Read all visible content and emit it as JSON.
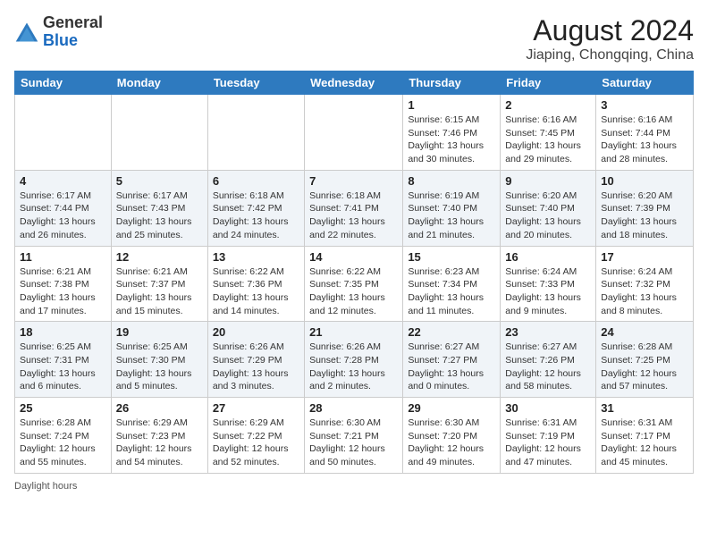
{
  "header": {
    "logo_general": "General",
    "logo_blue": "Blue",
    "month_year": "August 2024",
    "location": "Jiaping, Chongqing, China"
  },
  "weekdays": [
    "Sunday",
    "Monday",
    "Tuesday",
    "Wednesday",
    "Thursday",
    "Friday",
    "Saturday"
  ],
  "weeks": [
    [
      {
        "day": "",
        "info": ""
      },
      {
        "day": "",
        "info": ""
      },
      {
        "day": "",
        "info": ""
      },
      {
        "day": "",
        "info": ""
      },
      {
        "day": "1",
        "info": "Sunrise: 6:15 AM\nSunset: 7:46 PM\nDaylight: 13 hours and 30 minutes."
      },
      {
        "day": "2",
        "info": "Sunrise: 6:16 AM\nSunset: 7:45 PM\nDaylight: 13 hours and 29 minutes."
      },
      {
        "day": "3",
        "info": "Sunrise: 6:16 AM\nSunset: 7:44 PM\nDaylight: 13 hours and 28 minutes."
      }
    ],
    [
      {
        "day": "4",
        "info": "Sunrise: 6:17 AM\nSunset: 7:44 PM\nDaylight: 13 hours and 26 minutes."
      },
      {
        "day": "5",
        "info": "Sunrise: 6:17 AM\nSunset: 7:43 PM\nDaylight: 13 hours and 25 minutes."
      },
      {
        "day": "6",
        "info": "Sunrise: 6:18 AM\nSunset: 7:42 PM\nDaylight: 13 hours and 24 minutes."
      },
      {
        "day": "7",
        "info": "Sunrise: 6:18 AM\nSunset: 7:41 PM\nDaylight: 13 hours and 22 minutes."
      },
      {
        "day": "8",
        "info": "Sunrise: 6:19 AM\nSunset: 7:40 PM\nDaylight: 13 hours and 21 minutes."
      },
      {
        "day": "9",
        "info": "Sunrise: 6:20 AM\nSunset: 7:40 PM\nDaylight: 13 hours and 20 minutes."
      },
      {
        "day": "10",
        "info": "Sunrise: 6:20 AM\nSunset: 7:39 PM\nDaylight: 13 hours and 18 minutes."
      }
    ],
    [
      {
        "day": "11",
        "info": "Sunrise: 6:21 AM\nSunset: 7:38 PM\nDaylight: 13 hours and 17 minutes."
      },
      {
        "day": "12",
        "info": "Sunrise: 6:21 AM\nSunset: 7:37 PM\nDaylight: 13 hours and 15 minutes."
      },
      {
        "day": "13",
        "info": "Sunrise: 6:22 AM\nSunset: 7:36 PM\nDaylight: 13 hours and 14 minutes."
      },
      {
        "day": "14",
        "info": "Sunrise: 6:22 AM\nSunset: 7:35 PM\nDaylight: 13 hours and 12 minutes."
      },
      {
        "day": "15",
        "info": "Sunrise: 6:23 AM\nSunset: 7:34 PM\nDaylight: 13 hours and 11 minutes."
      },
      {
        "day": "16",
        "info": "Sunrise: 6:24 AM\nSunset: 7:33 PM\nDaylight: 13 hours and 9 minutes."
      },
      {
        "day": "17",
        "info": "Sunrise: 6:24 AM\nSunset: 7:32 PM\nDaylight: 13 hours and 8 minutes."
      }
    ],
    [
      {
        "day": "18",
        "info": "Sunrise: 6:25 AM\nSunset: 7:31 PM\nDaylight: 13 hours and 6 minutes."
      },
      {
        "day": "19",
        "info": "Sunrise: 6:25 AM\nSunset: 7:30 PM\nDaylight: 13 hours and 5 minutes."
      },
      {
        "day": "20",
        "info": "Sunrise: 6:26 AM\nSunset: 7:29 PM\nDaylight: 13 hours and 3 minutes."
      },
      {
        "day": "21",
        "info": "Sunrise: 6:26 AM\nSunset: 7:28 PM\nDaylight: 13 hours and 2 minutes."
      },
      {
        "day": "22",
        "info": "Sunrise: 6:27 AM\nSunset: 7:27 PM\nDaylight: 13 hours and 0 minutes."
      },
      {
        "day": "23",
        "info": "Sunrise: 6:27 AM\nSunset: 7:26 PM\nDaylight: 12 hours and 58 minutes."
      },
      {
        "day": "24",
        "info": "Sunrise: 6:28 AM\nSunset: 7:25 PM\nDaylight: 12 hours and 57 minutes."
      }
    ],
    [
      {
        "day": "25",
        "info": "Sunrise: 6:28 AM\nSunset: 7:24 PM\nDaylight: 12 hours and 55 minutes."
      },
      {
        "day": "26",
        "info": "Sunrise: 6:29 AM\nSunset: 7:23 PM\nDaylight: 12 hours and 54 minutes."
      },
      {
        "day": "27",
        "info": "Sunrise: 6:29 AM\nSunset: 7:22 PM\nDaylight: 12 hours and 52 minutes."
      },
      {
        "day": "28",
        "info": "Sunrise: 6:30 AM\nSunset: 7:21 PM\nDaylight: 12 hours and 50 minutes."
      },
      {
        "day": "29",
        "info": "Sunrise: 6:30 AM\nSunset: 7:20 PM\nDaylight: 12 hours and 49 minutes."
      },
      {
        "day": "30",
        "info": "Sunrise: 6:31 AM\nSunset: 7:19 PM\nDaylight: 12 hours and 47 minutes."
      },
      {
        "day": "31",
        "info": "Sunrise: 6:31 AM\nSunset: 7:17 PM\nDaylight: 12 hours and 45 minutes."
      }
    ]
  ],
  "footer": {
    "note": "Daylight hours"
  }
}
